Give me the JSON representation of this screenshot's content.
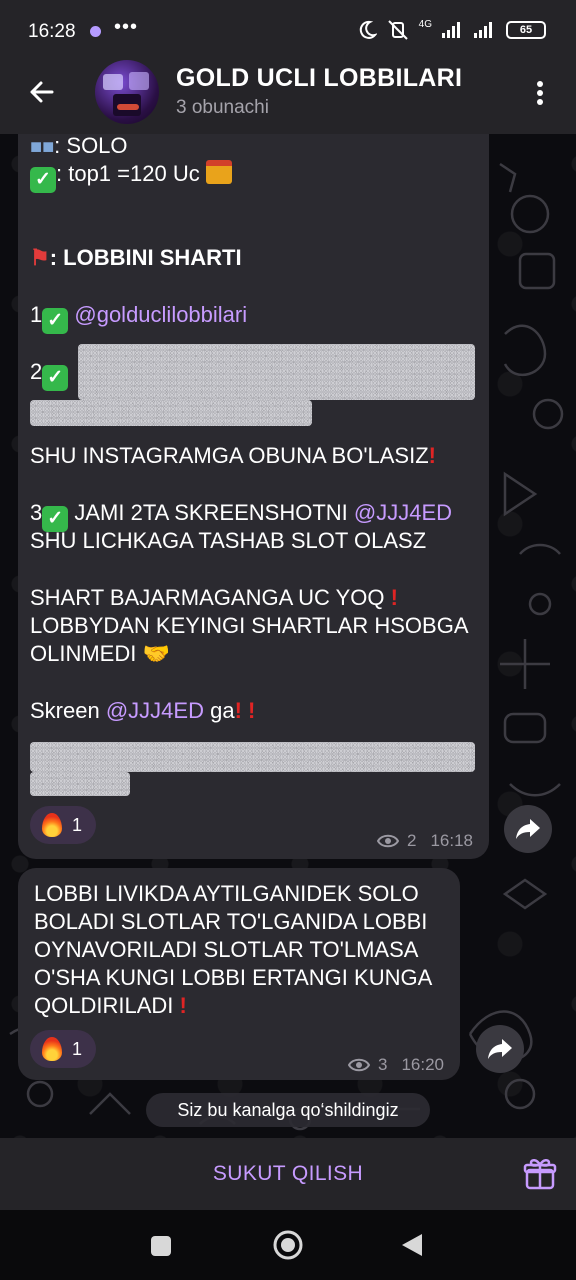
{
  "status_bar": {
    "time": "16:28",
    "more": "•••",
    "network": "4G",
    "battery": "65"
  },
  "header": {
    "title": "GOLD UCLI LOBBILARI",
    "subtitle": "3 obunachi"
  },
  "messages": [
    {
      "line_solo": ": SOLO",
      "line_top": ": top1 =120 Uc ",
      "line_title": ": LOBBINI SHARTI",
      "item1_num": "1",
      "item1_link": "@golduclilobbilari",
      "item2_num": "2",
      "item2_text": "SHU INSTAGRAMGA OBUNA BO'LASIZ",
      "item3_num": "3",
      "item3_text_a": " JAMI 2TA SKREENSHOTNI ",
      "item3_link": "@JJJ4ED",
      "item3_text_b": "SHU LICHKAGA TASHAB SLOT OLASZ",
      "warn_a": "SHART BAJARMAGANGA UC YOQ ",
      "warn_b": "LOBBYDAN KEYINGI SHARTLAR HSOBGA",
      "warn_c": "OLINMEDI ",
      "skreen_a": "Skreen ",
      "skreen_link": "@JJJ4ED",
      "skreen_b": " ga",
      "reaction_count": "1",
      "views": "2",
      "time": "16:18"
    },
    {
      "text": "LOBBI LIVIKDA AYTILGANIDEK SOLO BOLADI SLOTLAR TO'LGANIDA LOBBI OYNAVORILADI SLOTLAR TO'LMASA O'SHA KUNGI LOBBI ERTANGI KUNGA QOLDIRILADI ",
      "reaction_count": "1",
      "views": "3",
      "time": "16:20"
    }
  ],
  "joined_notice": "Siz bu kanalga qo‘shildingiz",
  "bottom_bar": {
    "mute_label": "SUKUT QILISH"
  },
  "colors": {
    "accent": "#c79bff",
    "bubble": "#2b2a30",
    "header": "#252428",
    "check_green": "#35b84b",
    "alert_red": "#e02424"
  }
}
